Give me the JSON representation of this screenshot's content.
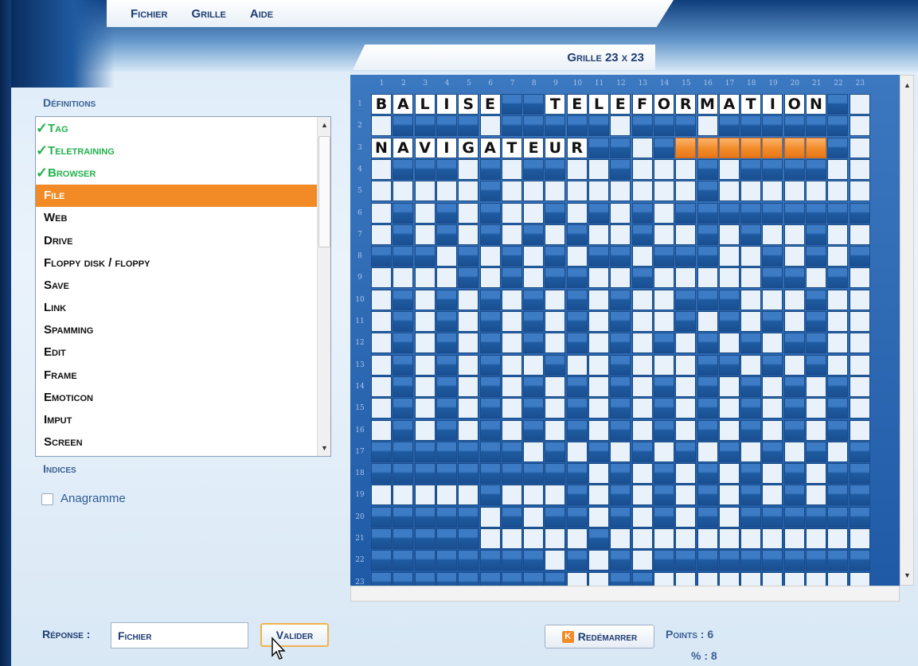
{
  "menu": [
    "Fichier",
    "Grille",
    "Aide"
  ],
  "grid_title": "Grille 23 x 23",
  "definitions_label": "Définitions",
  "definitions": [
    {
      "label": "Tag",
      "done": true
    },
    {
      "label": "Teletraining",
      "done": true
    },
    {
      "label": "Browser",
      "done": true
    },
    {
      "label": "File",
      "selected": true
    },
    {
      "label": "Web"
    },
    {
      "label": "Drive"
    },
    {
      "label": "Floppy disk / floppy"
    },
    {
      "label": "Save"
    },
    {
      "label": "Link"
    },
    {
      "label": "Spamming"
    },
    {
      "label": "Edit"
    },
    {
      "label": "Frame"
    },
    {
      "label": "Emoticon"
    },
    {
      "label": "Imput"
    },
    {
      "label": "Screen"
    }
  ],
  "hints_label": "Indices",
  "anagram_label": "Anagramme",
  "grid": {
    "size": 23,
    "col_numbers": [
      "1",
      "2",
      "3",
      "4",
      "5",
      "6",
      "7",
      "8",
      "9",
      "10",
      "11",
      "12",
      "13",
      "14",
      "15",
      "16",
      "17",
      "18",
      "19",
      "20",
      "21",
      "22",
      "23"
    ],
    "row_numbers": [
      "1",
      "2",
      "3",
      "4",
      "5",
      "6",
      "7",
      "8",
      "9",
      "10",
      "11",
      "12",
      "13",
      "14",
      "15",
      "16",
      "17",
      "18",
      "19",
      "20",
      "21",
      "22",
      "23"
    ],
    "rows": [
      "BALISE##TELEFORMATION#.",
      ".####.#####.###.######.",
      "NAVIGATEUR##.#ooooooo#.",
      ".###.#.##..#...#.####..",
      ".....#.........#.......",
      ".#.#.#..#.#.#.#########",
      ".#.#.#.#.#..#..#.#..#..",
      "###.#.#.#.##.###..#.#.#",
      "....#.#.##..#.....##.#.",
      ".#.#.#.#.#.#..###...#..",
      ".#.#.#.#.#.#..#.#.#.#..",
      ".#.#.#.#.#.#.#.#.#.##..",
      ".#.#.#..#..#...##.#.#..",
      ".#.#.#.#.#.#.#.#.#.#.#.",
      ".#.#.#.#.#.#.#.#.#.#.#.",
      ".#.#.#.#.#.#.#.#.#.#.#.",
      "#######.#.#.#.#.#.#.#.#",
      "##########.#.#.#.#.#.##",
      ".....#...#.#.#.#.#.#.##",
      "#####.#.##.#.#.#.######",
      "#####.....#............",
      "########.#.#.##########",
      "#########..##.........."
    ]
  },
  "answer_label": "Réponse :",
  "answer_value": "Fichier",
  "validate_label": "Valider",
  "restart_label": "Redémarrer",
  "points_text": "Points : 6",
  "percent_text": "% : 8"
}
